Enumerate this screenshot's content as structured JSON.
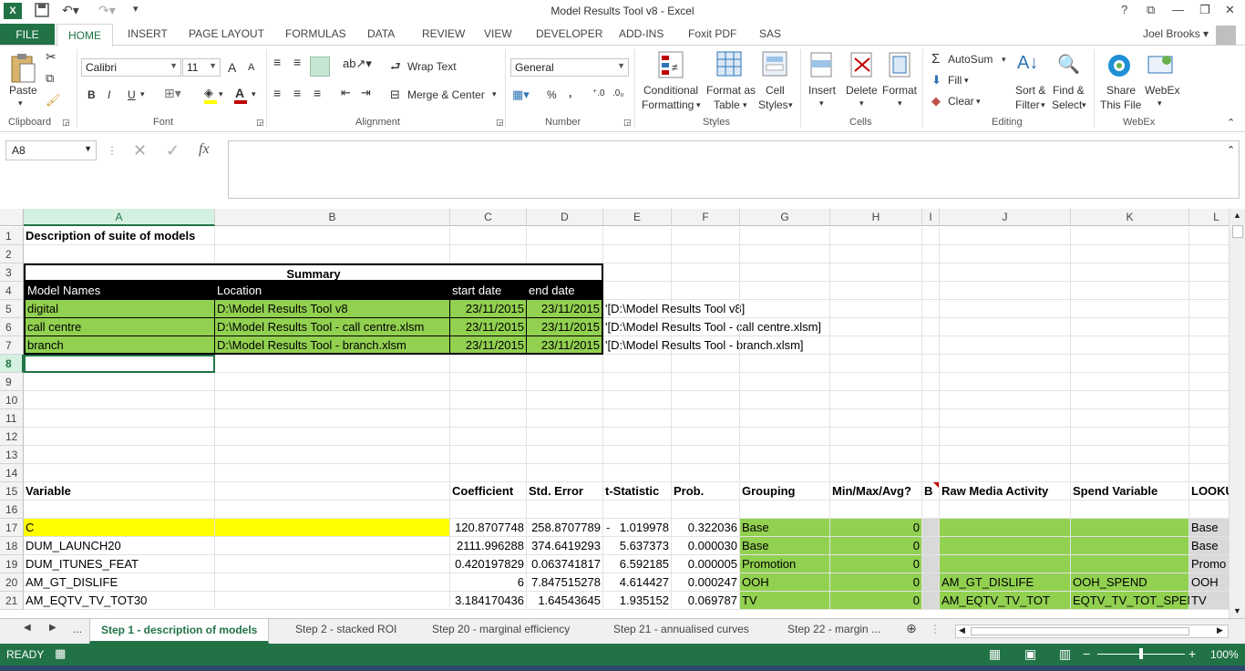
{
  "window": {
    "title": "Model Results Tool v8 - Excel",
    "help": "?",
    "logo": "X"
  },
  "ribbon_tabs": [
    "FILE",
    "HOME",
    "INSERT",
    "PAGE LAYOUT",
    "FORMULAS",
    "DATA",
    "REVIEW",
    "VIEW",
    "DEVELOPER",
    "ADD-INS",
    "Foxit PDF",
    "SAS"
  ],
  "user": "Joel Brooks",
  "ribbon": {
    "clipboard": {
      "paste": "Paste",
      "label": "Clipboard"
    },
    "font": {
      "name": "Calibri",
      "size": "11",
      "bold": "B",
      "italic": "I",
      "underline": "U",
      "grow": "A",
      "shrink": "A",
      "label": "Font"
    },
    "alignment": {
      "wrap": "Wrap Text",
      "merge": "Merge & Center",
      "label": "Alignment"
    },
    "number": {
      "format": "General",
      "percent": "%",
      "comma": ",",
      "label": "Number"
    },
    "styles": {
      "conditional": [
        "Conditional",
        "Formatting"
      ],
      "format_table": [
        "Format as",
        "Table"
      ],
      "cell_styles": [
        "Cell",
        "Styles"
      ],
      "label": "Styles"
    },
    "cells": {
      "insert": "Insert",
      "delete": "Delete",
      "format": "Format",
      "label": "Cells"
    },
    "editing": {
      "autosum": "AutoSum",
      "fill": "Fill",
      "clear": "Clear",
      "sort": [
        "Sort &",
        "Filter"
      ],
      "find": [
        "Find &",
        "Select"
      ],
      "label": "Editing"
    },
    "webex_grp": {
      "share": [
        "Share",
        "This File"
      ],
      "webex": [
        "WebEx",
        ""
      ],
      "label": "WebEx"
    }
  },
  "formula_bar": {
    "namebox": "A8",
    "fx": "fx",
    "value": ""
  },
  "columns": [
    "A",
    "B",
    "C",
    "D",
    "E",
    "F",
    "G",
    "H",
    "I",
    "J",
    "K",
    "L"
  ],
  "col_l_visible": "",
  "rows": [
    {
      "n": "1",
      "cells": {
        "A": "Description of suite of models"
      }
    },
    {
      "n": "2",
      "cells": {}
    },
    {
      "n": "3",
      "cells": {
        "A": "Summary"
      }
    },
    {
      "n": "4",
      "cells": {
        "A": "Model Names",
        "B": "Location",
        "C": "start date",
        "D": "end date"
      }
    },
    {
      "n": "5",
      "cells": {
        "A": "digital",
        "B": "D:\\Model Results Tool v8",
        "C": "23/11/2015",
        "D": "23/11/2015",
        "E": "'[D:\\Model Results Tool v8]"
      }
    },
    {
      "n": "6",
      "cells": {
        "A": "call centre",
        "B": "D:\\Model Results Tool - call centre.xlsm",
        "C": "23/11/2015",
        "D": "23/11/2015",
        "E": "'[D:\\Model Results Tool - call centre.xlsm]"
      }
    },
    {
      "n": "7",
      "cells": {
        "A": "branch",
        "B": "D:\\Model Results Tool - branch.xlsm",
        "C": "23/11/2015",
        "D": "23/11/2015",
        "E": "'[D:\\Model Results Tool - branch.xlsm]"
      }
    },
    {
      "n": "8",
      "cells": {}
    },
    {
      "n": "9",
      "cells": {}
    },
    {
      "n": "10",
      "cells": {}
    },
    {
      "n": "11",
      "cells": {}
    },
    {
      "n": "12",
      "cells": {}
    },
    {
      "n": "13",
      "cells": {}
    },
    {
      "n": "14",
      "cells": {}
    },
    {
      "n": "15",
      "cells": {
        "A": "Variable",
        "C": "Coefficient",
        "D": "Std. Error",
        "E": "t-Statistic",
        "F": "Prob.",
        "G": "Grouping",
        "H": "Min/Max/Avg?",
        "I": "B",
        "J": "Raw Media Activity",
        "K": "Spend Variable",
        "L": "LOOKU"
      }
    },
    {
      "n": "16",
      "cells": {}
    },
    {
      "n": "17",
      "cells": {
        "A": "C",
        "C": "120.8707748",
        "D": "258.8707789",
        "E": "1.019978",
        "F": "0.322036",
        "G": "Base",
        "H": "0",
        "L": "Base"
      }
    },
    {
      "n": "18",
      "cells": {
        "A": "DUM_LAUNCH20",
        "C": "2111.996288",
        "D": "374.6419293",
        "E": "5.637373",
        "F": "0.000030",
        "G": "Base",
        "H": "0",
        "L": "Base"
      }
    },
    {
      "n": "19",
      "cells": {
        "A": "DUM_ITUNES_FEAT",
        "C": "0.420197829",
        "D": "0.063741817",
        "E": "6.592185",
        "F": "0.000005",
        "G": "Promotion",
        "H": "0",
        "L": "Promo"
      }
    },
    {
      "n": "20",
      "cells": {
        "A": "AM_GT_DISLIFE",
        "C": "6",
        "D": "7.847515278",
        "E": "4.614427",
        "F": "0.000247",
        "G": "OOH",
        "H": "0",
        "J": "AM_GT_DISLIFE",
        "K": "OOH_SPEND",
        "L": "OOH"
      }
    },
    {
      "n": "21",
      "cells": {
        "A": "AM_EQTV_TV_TOT30",
        "C": "3.184170436",
        "D": "1.64543645",
        "E": "1.935152",
        "F": "0.069787",
        "G": "TV",
        "H": "0",
        "J": "AM_EQTV_TV_TOT",
        "K": "EQTV_TV_TOT_SPEN",
        "L": "TV"
      }
    }
  ],
  "e_dash": "-",
  "sheets": [
    "...",
    "Step 1 - description of models",
    "Step 2 - stacked ROI",
    "Step 20 - marginal efficiency",
    "Step 21 - annualised curves",
    "Step 22 - margin ..."
  ],
  "status": {
    "ready": "READY",
    "zoom": "100%"
  },
  "colors": {
    "accent": "#217346",
    "green_fill": "#92d050",
    "yellow_fill": "#ffff00",
    "grey_fill": "#d9d9d9",
    "black_fill": "#000000"
  }
}
